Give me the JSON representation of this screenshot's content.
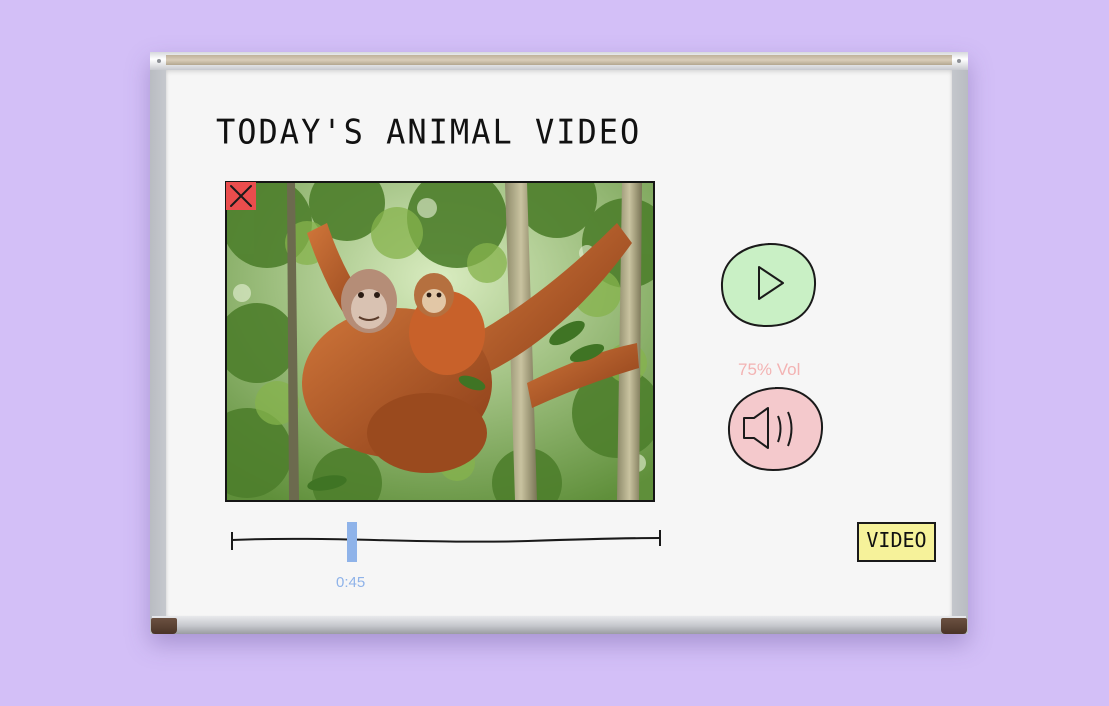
{
  "page": {
    "title": "TODAY'S ANIMAL VIDEO"
  },
  "video": {
    "thumbnail": "orangutan mother holding baby in jungle trees",
    "close_icon": "close-x-icon"
  },
  "controls": {
    "play_icon": "play-icon",
    "volume_label": "75% Vol",
    "volume_icon": "speaker-icon",
    "current_time": "0:45",
    "video_button_label": "VIDEO"
  },
  "colors": {
    "background": "#d3bff7",
    "close_button": "#ea4d4d",
    "play_button": "#c9f0c5",
    "mute_button": "#f4c9cc",
    "scrubber": "#8fb3e9",
    "volume_text": "#f3b3b3",
    "video_button": "#f6f29a"
  }
}
